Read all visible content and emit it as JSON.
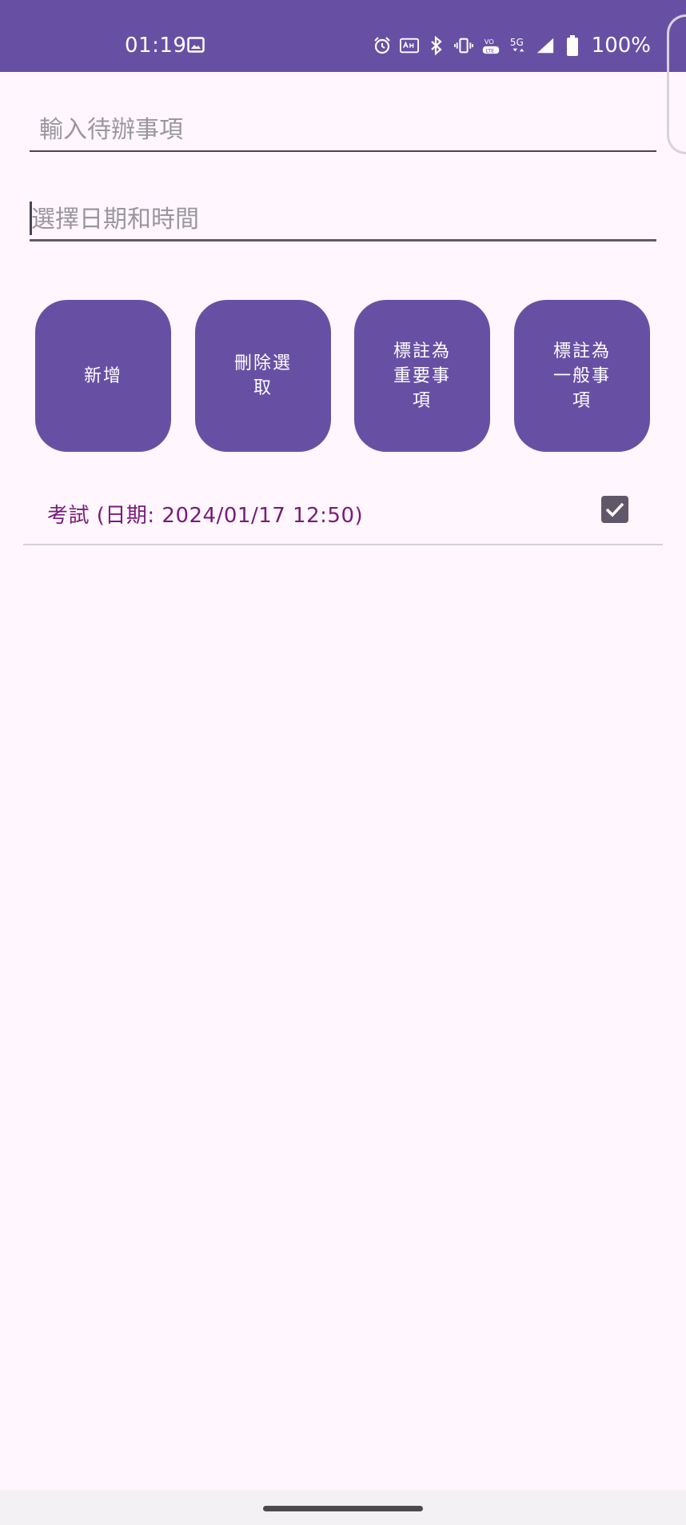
{
  "status_bar": {
    "time": "01:19",
    "battery": "100%",
    "icons": [
      "image-icon",
      "alarm-icon",
      "auto-hd-icon",
      "bluetooth-icon",
      "vibrate-icon",
      "volte-icon",
      "5g-icon",
      "signal-icon",
      "battery-icon"
    ],
    "network_label": "5G",
    "color": "#6750A4"
  },
  "form": {
    "todo_placeholder": "輸入待辦事項",
    "date_placeholder": "選擇日期和時間"
  },
  "buttons": {
    "add": "新增",
    "delete_selected": "刪除選\n取",
    "mark_important": "標註為\n重要事\n項",
    "mark_normal": "標註為\n一般事\n項"
  },
  "todo_items": [
    {
      "text": "考試 (日期: 2024/01/17 12:50)",
      "checked": true
    }
  ]
}
